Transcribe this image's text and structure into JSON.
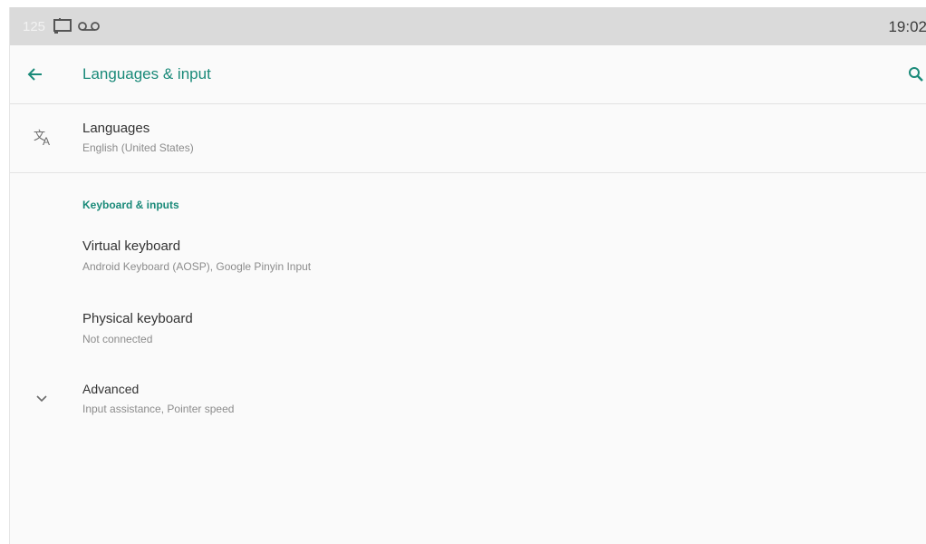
{
  "status_bar": {
    "notification_count": "125",
    "time": "19:02"
  },
  "app_bar": {
    "title": "Languages & input",
    "back_icon": "arrow-back-icon",
    "search_icon": "search-icon"
  },
  "languages": {
    "title": "Languages",
    "summary": "English (United States)",
    "icon": "translate-icon"
  },
  "keyboard_category": {
    "title": "Keyboard & inputs"
  },
  "virtual_keyboard": {
    "title": "Virtual keyboard",
    "summary": "Android Keyboard (AOSP), Google Pinyin Input"
  },
  "physical_keyboard": {
    "title": "Physical keyboard",
    "summary": "Not connected"
  },
  "advanced": {
    "title": "Advanced",
    "summary": "Input assistance, Pointer speed",
    "icon": "chevron-down-icon"
  },
  "colors": {
    "accent": "#1a8a79",
    "status_bar": "#dadada",
    "background": "#fafafa"
  }
}
